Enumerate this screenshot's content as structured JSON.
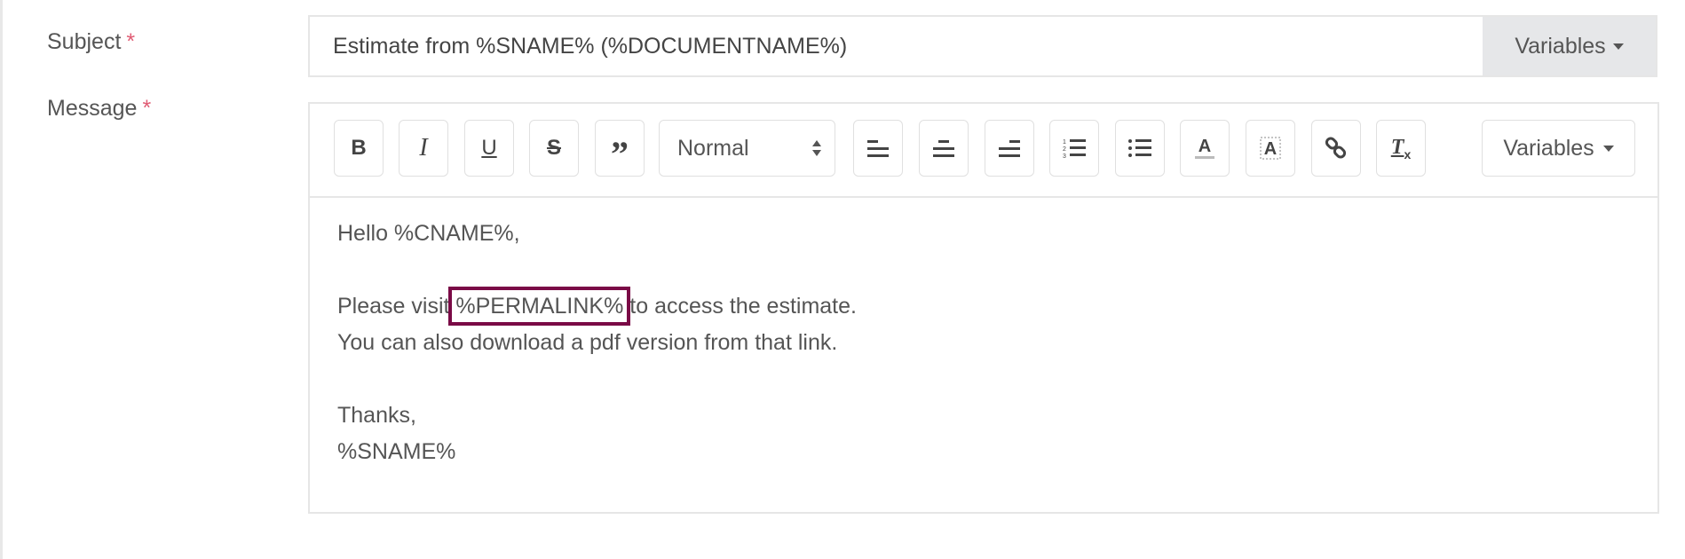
{
  "subject": {
    "label": "Subject",
    "required_mark": "*",
    "value": "Estimate from %SNAME% (%DOCUMENTNAME%)",
    "variables_label": "Variables"
  },
  "message": {
    "label": "Message",
    "required_mark": "*",
    "toolbar": {
      "buttons": [
        "bold-icon",
        "italic-icon",
        "underline-icon",
        "strikethrough-icon",
        "blockquote-icon",
        "align-left-icon",
        "align-center-icon",
        "align-right-icon",
        "ordered-list-icon",
        "bullet-list-icon",
        "text-color-icon",
        "background-color-icon",
        "link-icon",
        "clear-formatting-icon"
      ],
      "format_select": "Normal",
      "variables_label": "Variables"
    },
    "body": {
      "line1": "Hello %CNAME%,",
      "line2_before": "Please visit ",
      "line2_highlight": "%PERMALINK%",
      "line2_after": " to access the estimate.",
      "line3": "You can also download a pdf version from that link.",
      "line4": "Thanks,",
      "line5": "%SNAME%"
    },
    "highlight_color": "#7a0a46"
  }
}
